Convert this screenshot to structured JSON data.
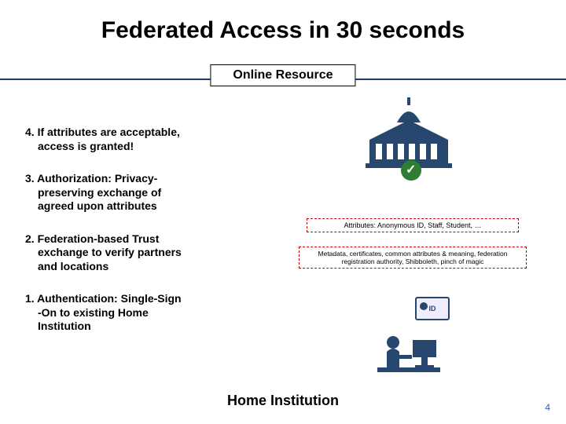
{
  "title": "Federated Access in 30 seconds",
  "labels": {
    "online_resource": "Online Resource",
    "home_institution": "Home Institution"
  },
  "steps": {
    "s4": {
      "num": "4.",
      "line1": "If attributes are acceptable,",
      "line2": "access is granted!"
    },
    "s3": {
      "num": "3.",
      "line1": "Authorization: Privacy-",
      "line2": "preserving exchange of",
      "line3": "agreed upon attributes"
    },
    "s2": {
      "num": "2.",
      "line1": "Federation-based Trust",
      "line2": "exchange to verify partners",
      "line3": "and locations"
    },
    "s1": {
      "num": "1.",
      "line1": "Authentication: Single-Sign",
      "line2": "-On to existing Home",
      "line3": "Institution"
    }
  },
  "callouts": {
    "attributes": "Attributes: Anonymous ID, Staff, Student, …",
    "metadata": "Metadata, certificates, common attributes & meaning, federation registration authority, Shibboleth, pinch of magic"
  },
  "id_card_label": "ID",
  "page_number": "4",
  "colors": {
    "brand_line": "#1f3b73",
    "callout_border": "#c00",
    "check": "#2e7d32",
    "page_num": "#3b5aa6"
  }
}
